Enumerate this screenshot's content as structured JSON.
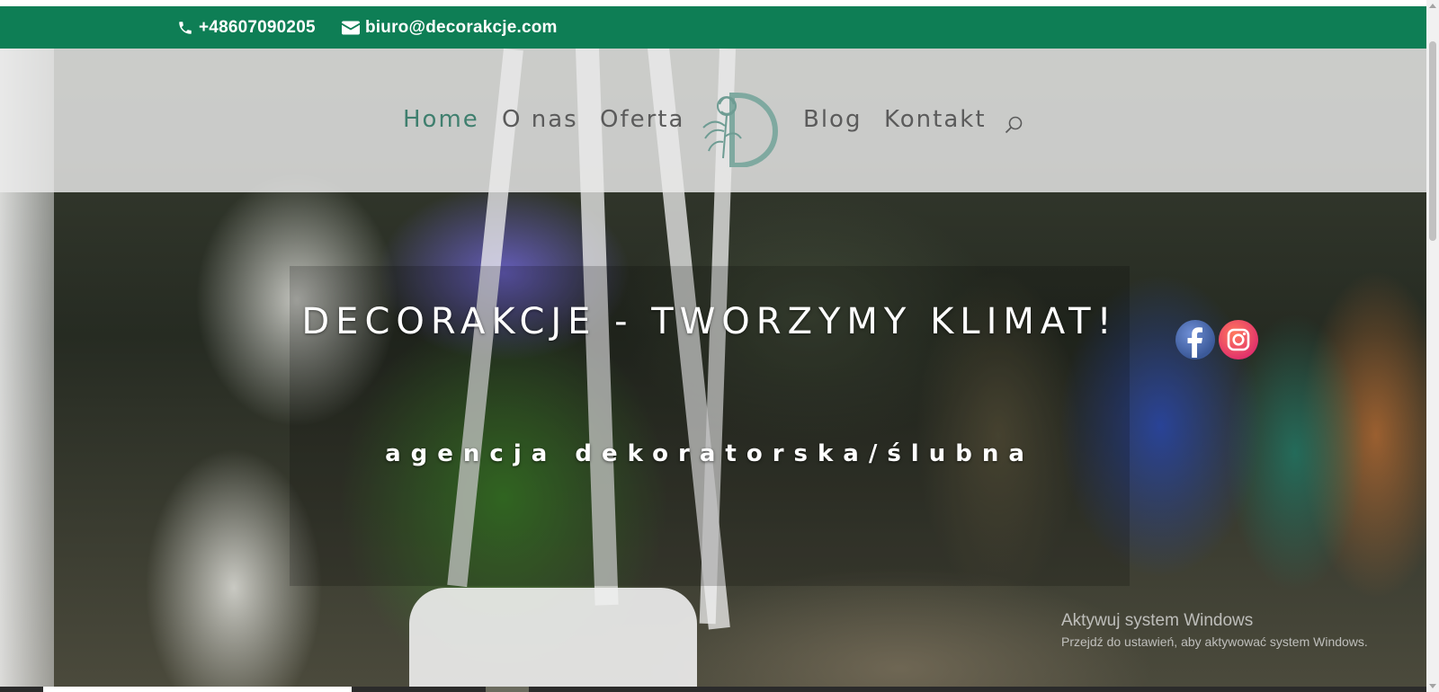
{
  "topbar": {
    "phone": "+48607090205",
    "email": "biuro@decorakcje.com",
    "bg_color": "#0e7e55"
  },
  "nav": {
    "items": [
      {
        "label": "Home",
        "active": true
      },
      {
        "label": "O nas"
      },
      {
        "label": "Oferta"
      },
      {
        "label": "Blog"
      },
      {
        "label": "Kontakt"
      }
    ],
    "logo_icon": "decorakcje-logo-d-flower",
    "search_icon": "search-icon",
    "active_color": "#3f7f6e"
  },
  "hero": {
    "title": "DECORAKCJE - TWORZYMY KLIMAT!",
    "subtitle": "agencja dekoratorska/ślubna",
    "social": [
      {
        "icon": "facebook-icon"
      },
      {
        "icon": "instagram-icon"
      }
    ]
  },
  "watermark": {
    "line1": "Aktywuj system Windows",
    "line2": "Przejdź do ustawień, aby aktywować system Windows."
  }
}
